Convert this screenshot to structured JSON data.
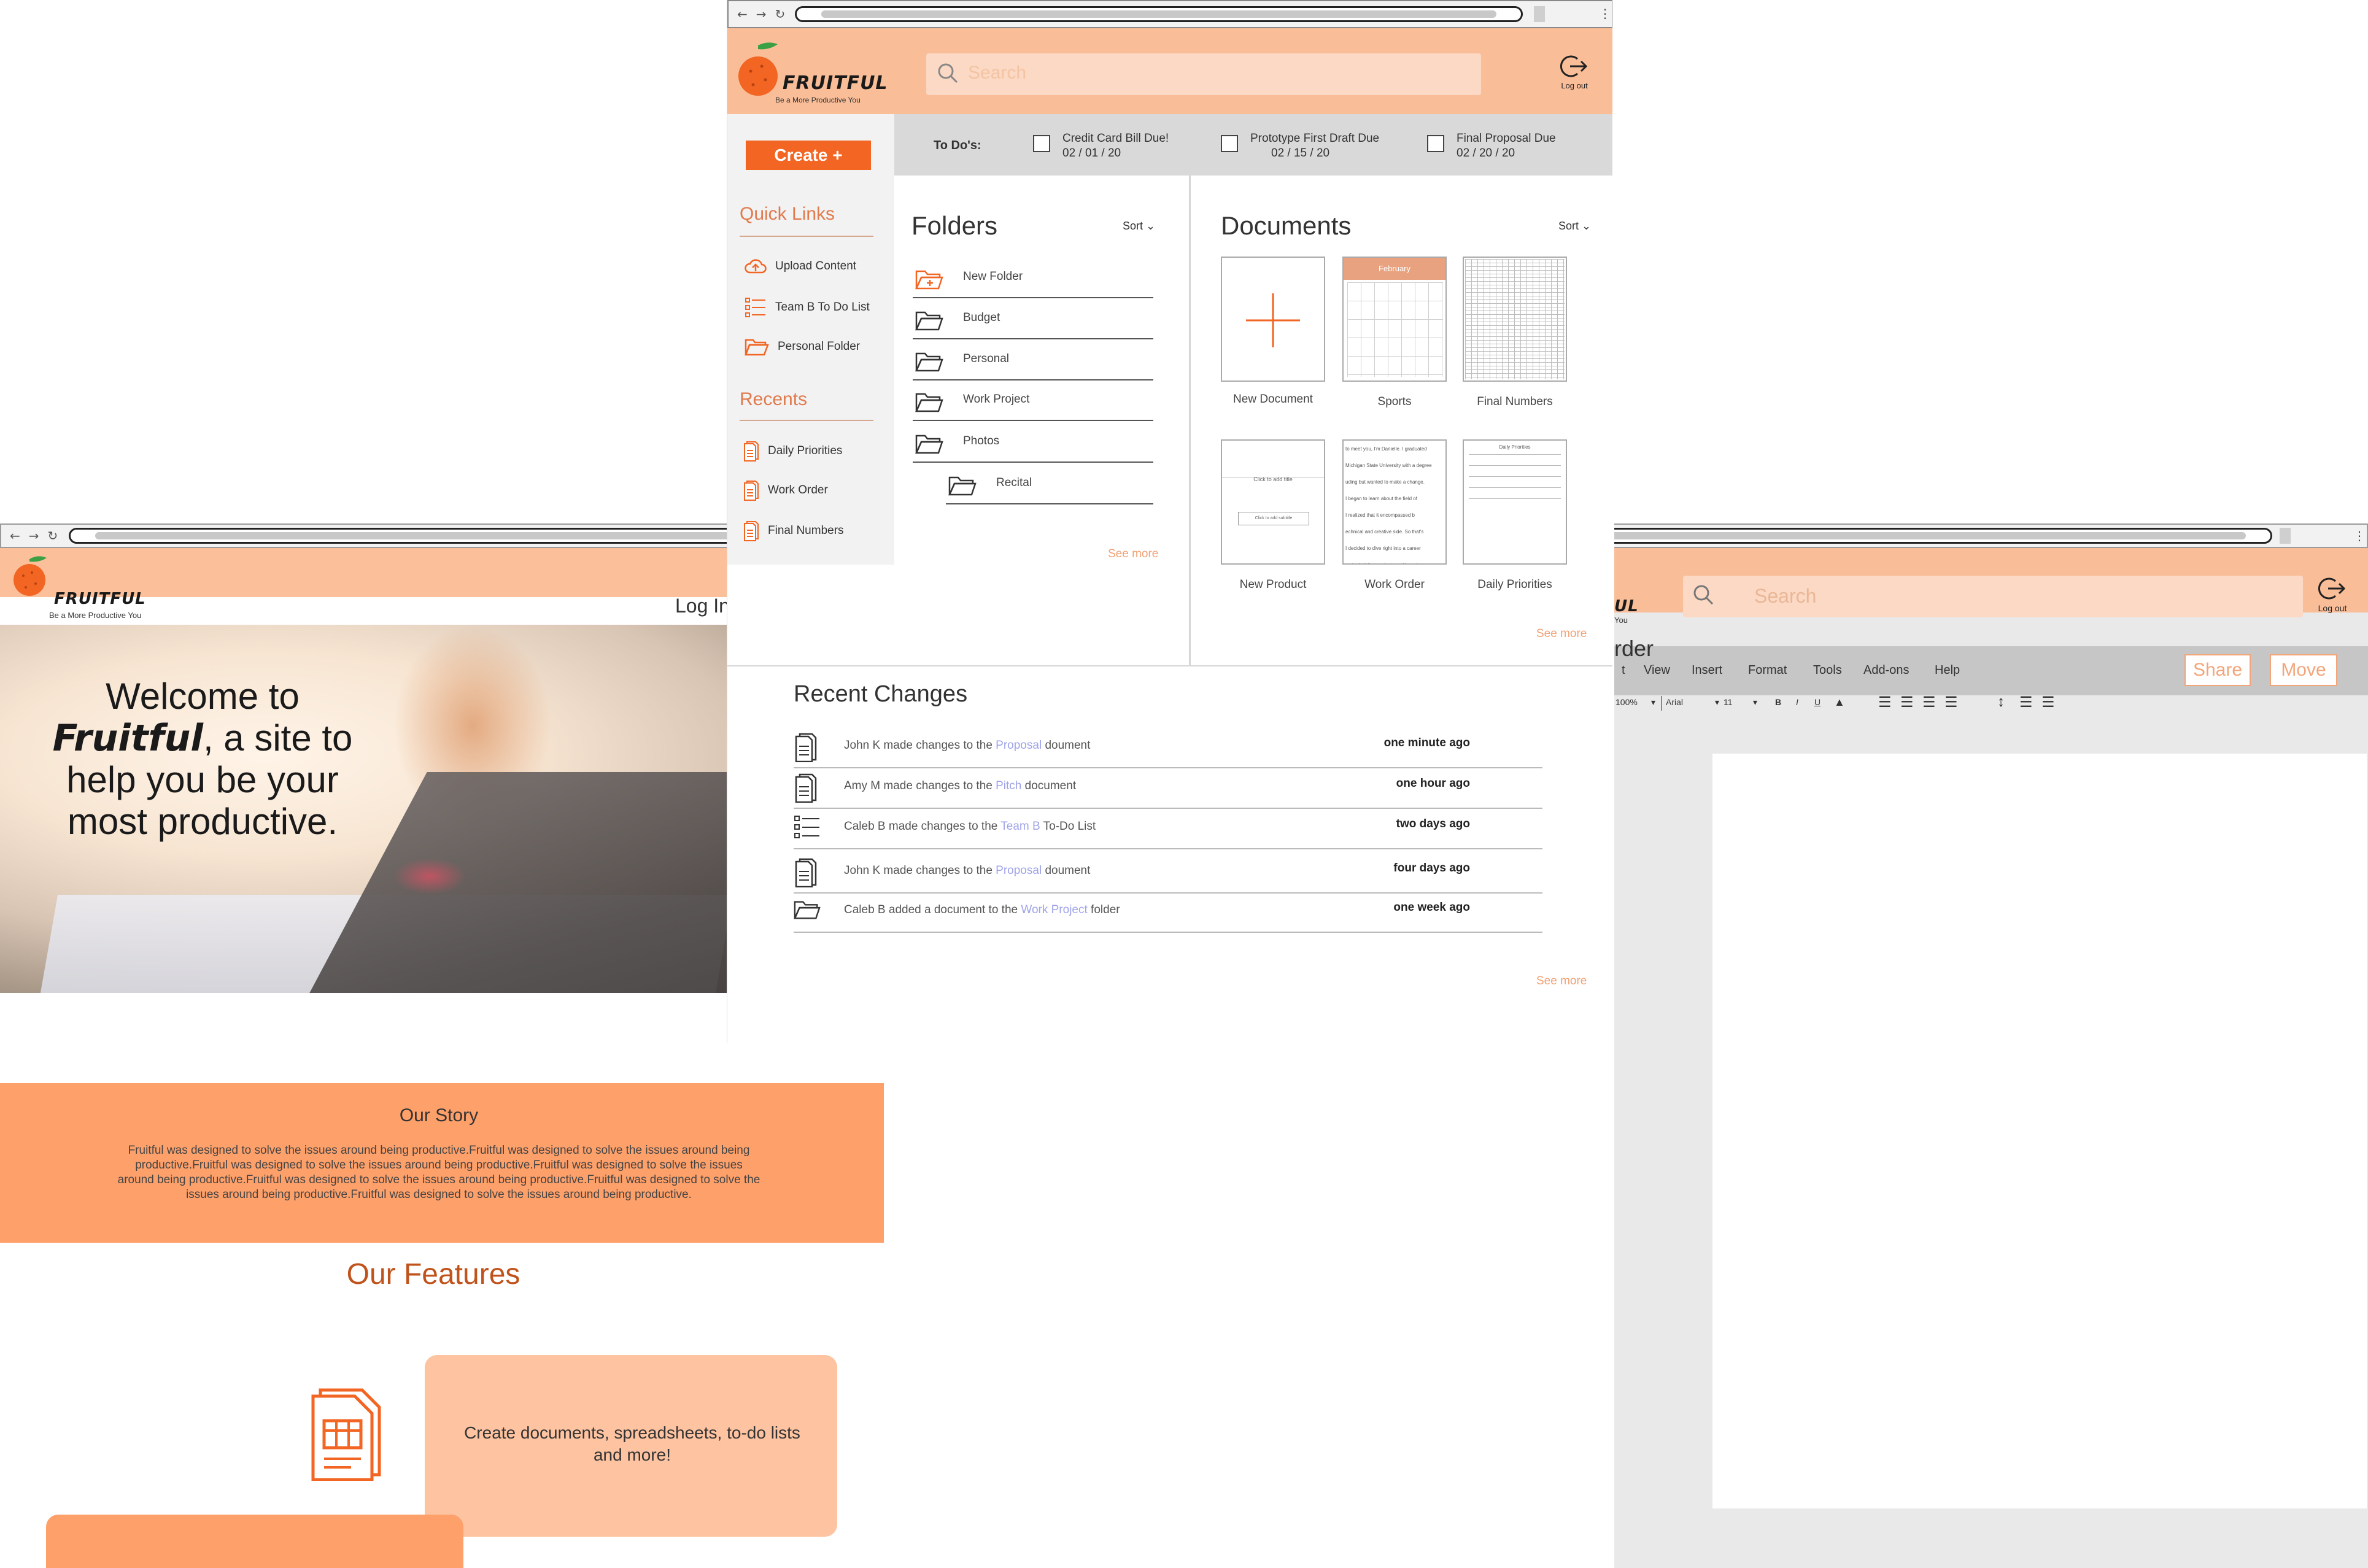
{
  "colors": {
    "accent": "#f26522",
    "header": "#f9bd98",
    "salmon": "#fea06a",
    "link": "#9ea3e8",
    "section": "#e07a4d"
  },
  "brand": {
    "name": "FRUITFUL",
    "tagline": "Be a More Productive You"
  },
  "landing": {
    "login": "Log In",
    "hero_line1": "Welcome to",
    "hero_brand": "Fruitful",
    "hero_line2_rest": ", a site to",
    "hero_line3": "help you be your",
    "hero_line4": "most productive.",
    "story_title": "Our Story",
    "story_body": "Fruitful was designed to solve the issues around being productive.Fruitful was designed to solve the issues around being productive.Fruitful was designed to solve the issues around being productive.Fruitful was designed to solve the issues around being productive.Fruitful was designed to solve the issues around being productive.Fruitful was designed to solve the issues around being productive.Fruitful was designed to solve the issues around being productive.",
    "features_title": "Our Features",
    "feature_text": "Create documents, spreadsheets, to-do lists and more!"
  },
  "dashboard": {
    "search_placeholder": "Search",
    "logout": "Log out",
    "create": "Create +",
    "todo_label": "To Do's:",
    "todos": [
      {
        "text": "Credit Card Bill Due!",
        "date": "02 / 01 / 20"
      },
      {
        "text": "Prototype First Draft Due",
        "date": "02 / 15 / 20"
      },
      {
        "text": "Final Proposal Due",
        "date": "02 / 20 / 20"
      }
    ],
    "quick_links_title": "Quick Links",
    "quick_links": [
      "Upload Content",
      "Team B To Do List",
      "Personal Folder"
    ],
    "recents_title": "Recents",
    "recents": [
      "Daily Priorities",
      "Work Order",
      "Final Numbers"
    ],
    "folders_title": "Folders",
    "sort": "Sort",
    "folders": [
      "New Folder",
      "Budget",
      "Personal",
      "Work Project",
      "Photos",
      "Recital"
    ],
    "see_more": "See more",
    "documents_title": "Documents",
    "documents": [
      "New Document",
      "Sports",
      "Final Numbers",
      "New Product",
      "Work Order",
      "Daily Priorities"
    ],
    "calendar_month": "February",
    "product_click_title": "Click to add title",
    "product_click_subtitle": "Click to add subtitle",
    "work_order_lines": [
      "to meet you, I'm Danielle. I graduated",
      "Michigan State University with a degree",
      "uding but wanted to make a change.",
      "I began to learn about the field of",
      "I realized that it encompassed b",
      "echnical and creative side. So that's",
      "I decided to dive right into a career",
      "ge by building projects and learning"
    ],
    "daily_priorities_title": "Daily Priorities",
    "recent_changes_title": "Recent Changes",
    "recent_changes": [
      {
        "pre": "John K made changes to the ",
        "link": "Proposal",
        "post": " doument",
        "ago": "one minute ago",
        "icon": "document-icon"
      },
      {
        "pre": "Amy M made changes to the ",
        "link": "Pitch",
        "post": " document",
        "ago": "one hour ago",
        "icon": "document-icon"
      },
      {
        "pre": "Caleb B made changes to the ",
        "link": "Team B",
        "post": " To-Do List",
        "ago": "two days ago",
        "icon": "checklist-icon"
      },
      {
        "pre": "John K made changes to the ",
        "link": "Proposal",
        "post": " doument",
        "ago": "four days ago",
        "icon": "document-icon"
      },
      {
        "pre": "Caleb B added a document to the ",
        "link": "Work Project",
        "post": " folder",
        "ago": "one week ago",
        "icon": "folder-icon"
      }
    ]
  },
  "editor": {
    "search_placeholder": "Search",
    "logout": "Log out",
    "brand_tail": "UL",
    "tag_tail": "You",
    "doc_title_tail": "rder",
    "menus": [
      "t",
      "View",
      "Insert",
      "Format",
      "Tools",
      "Add-ons",
      "Help"
    ],
    "share": "Share",
    "move": "Move",
    "zoom": "100%",
    "font": "Arial",
    "size": "11",
    "bold": "B",
    "italic": "I",
    "underline": "U"
  }
}
